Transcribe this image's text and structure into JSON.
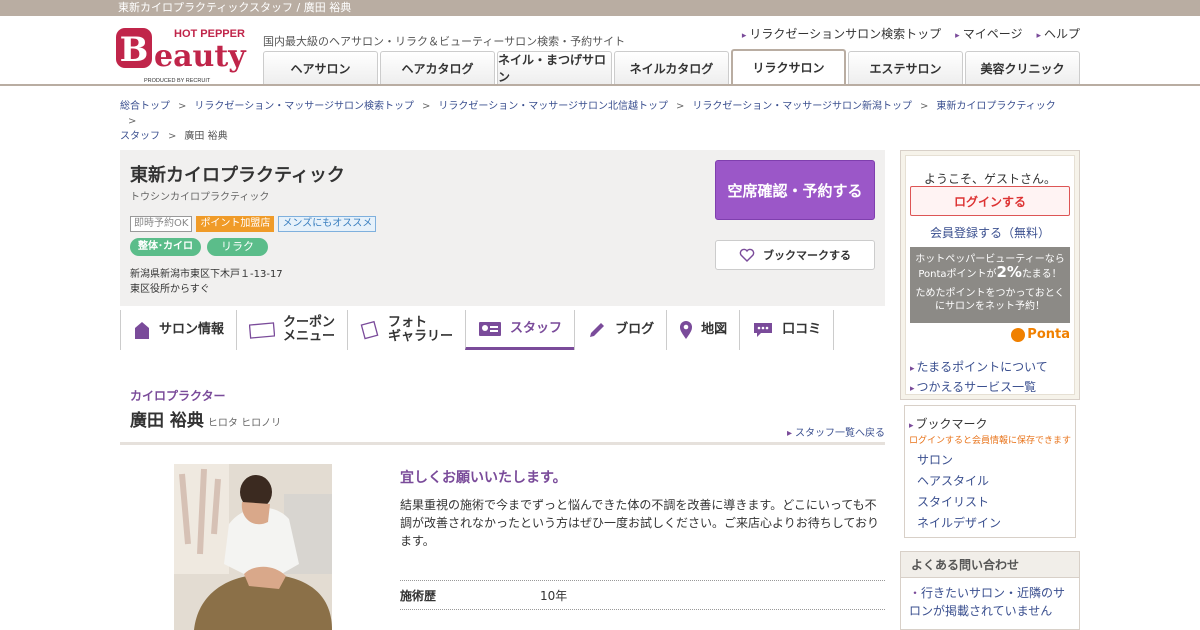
{
  "topbar": {
    "text": "東新カイロプラクティックスタッフ / 廣田 裕典"
  },
  "header": {
    "logo_top": "HOT PEPPER",
    "logo_main": "Beauty",
    "logo_sub": "PRODUCED BY RECRUIT",
    "tagline": "国内最大級のヘアサロン・リラク＆ビューティーサロン検索・予約サイト",
    "utility_links": [
      "リラクゼーションサロン検索トップ",
      "マイページ",
      "ヘルプ"
    ],
    "tabs": [
      "ヘアサロン",
      "ヘアカタログ",
      "ネイル・まつげサロン",
      "ネイルカタログ",
      "リラクサロン",
      "エステサロン",
      "美容クリニック"
    ],
    "active_tab": "リラクサロン"
  },
  "breadcrumb": {
    "items": [
      "総合トップ",
      "リラクゼーション・マッサージサロン検索トップ",
      "リラクゼーション・マッサージサロン北信越トップ",
      "リラクゼーション・マッサージサロン新潟トップ",
      "東新カイロプラクティック",
      "スタッフ"
    ],
    "current": "廣田 裕典"
  },
  "salon": {
    "name": "東新カイロプラクティック",
    "kana": "トウシンカイロプラクティック",
    "badges": [
      "即時予約OK",
      "ポイント加盟店",
      "メンズにもオススメ"
    ],
    "genres": [
      "整体･カイロ",
      "リラク"
    ],
    "address": "新潟県新潟市東区下木戸１-13-17",
    "access": "東区役所からすぐ",
    "reserve_label": "空席確認・予約する",
    "bookmark_label": "ブックマークする"
  },
  "subnav": {
    "items": [
      {
        "label": "サロン情報",
        "icon": "house-icon"
      },
      {
        "label": "クーポン\nメニュー",
        "icon": "coupon-icon"
      },
      {
        "label": "フォト\nギャラリー",
        "icon": "photo-icon"
      },
      {
        "label": "スタッフ",
        "icon": "staff-card-icon"
      },
      {
        "label": "ブログ",
        "icon": "pencil-icon"
      },
      {
        "label": "地図",
        "icon": "map-pin-icon"
      },
      {
        "label": "口コミ",
        "icon": "chat-icon"
      }
    ],
    "active": "スタッフ"
  },
  "staff": {
    "role": "カイロプラクター",
    "name": "廣田 裕典",
    "kana": "ヒロタ ヒロノリ",
    "back_link": "スタッフ一覧へ戻る",
    "greeting": "宜しくお願いいたします。",
    "message": "結果重視の施術で今までずっと悩んできた体の不調を改善に導きます。どこにいっても不調が改善されなかったという方はぜひ一度お試しください。ご来店心よりお待ちしております。",
    "details": [
      {
        "label": "施術歴",
        "value": "10年"
      }
    ]
  },
  "sidebar": {
    "welcome": "ようこそ、ゲストさん。",
    "login_label": "ログインする",
    "register_label": "会員登録する（無料）",
    "ponta_line1": "ホットペッパービューティーなら",
    "ponta_line2_a": "Pontaポイントが",
    "ponta_line2_b": "2%",
    "ponta_line2_c": "たまる！",
    "ponta_line3": "ためたポイントをつかっておとく",
    "ponta_line4": "にサロンをネット予約！",
    "ponta_logo": "Ponta",
    "links": [
      "たまるポイントについて",
      "つかえるサービス一覧"
    ],
    "bookmark_title": "ブックマーク",
    "bookmark_note": "ログインすると会員情報に保存できます",
    "bookmark_items": [
      "サロン",
      "ヘアスタイル",
      "スタイリスト",
      "ネイルデザイン"
    ],
    "faq_title": "よくある問い合わせ",
    "faq_items": [
      "行きたいサロン・近隣のサロンが掲載されていません"
    ]
  },
  "colors": {
    "accent_purple": "#7a4b9a",
    "reserve_button": "#9b57c8",
    "header_bar": "#b9ada2",
    "logo_red": "#c0254a"
  }
}
